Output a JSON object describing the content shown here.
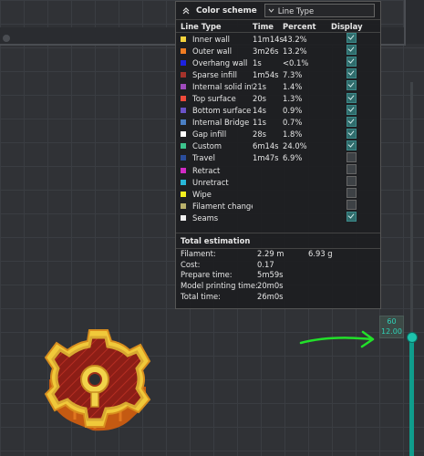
{
  "legend": {
    "title": "Color scheme",
    "scheme_value": "Line Type",
    "columns": {
      "type": "Line Type",
      "time": "Time",
      "percent": "Percent",
      "display": "Display"
    },
    "rows": [
      {
        "label": "Inner wall",
        "time": "11m14s",
        "percent": "43.2%",
        "color": "#f4d33c",
        "checked": true
      },
      {
        "label": "Outer wall",
        "time": "3m26s",
        "percent": "13.2%",
        "color": "#ef7c22",
        "checked": true
      },
      {
        "label": "Overhang wall",
        "time": "1s",
        "percent": "<0.1%",
        "color": "#1d22e0",
        "checked": true
      },
      {
        "label": "Sparse infill",
        "time": "1m54s",
        "percent": "7.3%",
        "color": "#a6332b",
        "checked": true
      },
      {
        "label": "Internal solid infill",
        "time": "21s",
        "percent": "1.4%",
        "color": "#a04bbd",
        "checked": true
      },
      {
        "label": "Top surface",
        "time": "20s",
        "percent": "1.3%",
        "color": "#ef4a3b",
        "checked": true
      },
      {
        "label": "Bottom surface",
        "time": "14s",
        "percent": "0.9%",
        "color": "#6a52c7",
        "checked": true
      },
      {
        "label": "Internal Bridge",
        "time": "11s",
        "percent": "0.7%",
        "color": "#4a7fc4",
        "checked": true
      },
      {
        "label": "Gap infill",
        "time": "28s",
        "percent": "1.8%",
        "color": "#ffffff",
        "checked": true
      },
      {
        "label": "Custom",
        "time": "6m14s",
        "percent": "24.0%",
        "color": "#3cc48d",
        "checked": true
      },
      {
        "label": "Travel",
        "time": "1m47s",
        "percent": "6.9%",
        "color": "#2a4d9c",
        "checked": false
      },
      {
        "label": "Retract",
        "time": "",
        "percent": "",
        "color": "#d12ac4",
        "checked": false
      },
      {
        "label": "Unretract",
        "time": "",
        "percent": "",
        "color": "#28b7d8",
        "checked": false
      },
      {
        "label": "Wipe",
        "time": "",
        "percent": "",
        "color": "#f2ee1f",
        "checked": false
      },
      {
        "label": "Filament changes",
        "time": "",
        "percent": "",
        "color": "#b9b06b",
        "checked": false
      },
      {
        "label": "Seams",
        "time": "",
        "percent": "",
        "color": "#f0f0f0",
        "checked": true
      }
    ],
    "total_title": "Total estimation",
    "estimates": [
      {
        "label": "Filament:",
        "value": "2.29 m",
        "extra": "6.93 g"
      },
      {
        "label": "Cost:",
        "value": "0.17",
        "extra": ""
      },
      {
        "label": "Prepare time:",
        "value": "5m59s",
        "extra": ""
      },
      {
        "label": "Model printing time:",
        "value": "20m0s",
        "extra": ""
      },
      {
        "label": "Total time:",
        "value": "26m0s",
        "extra": ""
      }
    ]
  },
  "layer_slider": {
    "layer": "60",
    "height": "12.00"
  },
  "colors": {
    "accent": "#1ec3ad",
    "annotation_arrow": "#22e02a"
  }
}
